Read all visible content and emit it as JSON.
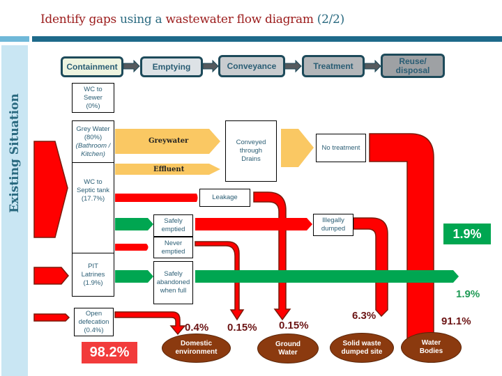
{
  "title": {
    "part1": "Identify gaps",
    "part2": "using a",
    "part3": "wastewater flow diagram",
    "part4": "(2/2)"
  },
  "side_label": "Existing Situation",
  "stages": [
    {
      "label": "Containment",
      "fill": "#eef4e0"
    },
    {
      "label": "Emptying",
      "fill": "#dde2e6"
    },
    {
      "label": "Conveyance",
      "fill": "#c9cccf"
    },
    {
      "label": "Treatment",
      "fill": "#b3b6b9"
    },
    {
      "label": "Reuse/ disposal",
      "fill": "#9ea1a4"
    }
  ],
  "containment_boxes": {
    "wc_sewer": {
      "line1": "WC to",
      "line2": "Sewer",
      "line3": "(0%)"
    },
    "grey_water": {
      "line1": "Grey Water",
      "line2": "(80%)",
      "line3": "(Bathroom /",
      "line4": "Kitchen)"
    },
    "wc_septic": {
      "line1": "WC to",
      "line2": "Septic tank",
      "line3": "(17.7%)"
    },
    "pit_latrines": {
      "line1": "PIT",
      "line2": "Latrines",
      "line3": "(1.9%)"
    },
    "open_defecation": {
      "line1": "Open",
      "line2": "defecation",
      "line3": "(0.4%)"
    }
  },
  "flow_labels": {
    "greywater": "Greywater",
    "effluent": "Effluent"
  },
  "process_boxes": {
    "conveyed": "Conveyed through Drains",
    "no_treatment": "No treatment",
    "leakage": "Leakage",
    "safely_emptied": "Safely emptied",
    "never_emptied": "Never emptied",
    "safely_abandoned": "Safely abandoned when full",
    "illegally_dumped": "Illegally dumped"
  },
  "totals": {
    "unsafe": "98.2%",
    "safe": "1.9%",
    "safe_abandoned": "1.9%"
  },
  "outcomes": [
    {
      "pct": "0.4%",
      "destination": "Domestic environment"
    },
    {
      "pct": "0.15%",
      "destination": ""
    },
    {
      "pct": "0.15%",
      "destination": "Ground Water"
    },
    {
      "pct": "6.3%",
      "destination": "Solid waste dumped site"
    },
    {
      "pct": "91.1%",
      "destination": "Water Bodies"
    }
  ],
  "colors": {
    "unsafe": "#ff0000",
    "unsafe_border": "#7a1a0a",
    "safe": "#00a651",
    "greywater": "#fac863",
    "total_unsafe_bg": "#f23b3b",
    "oval": "#8b3a0f"
  }
}
